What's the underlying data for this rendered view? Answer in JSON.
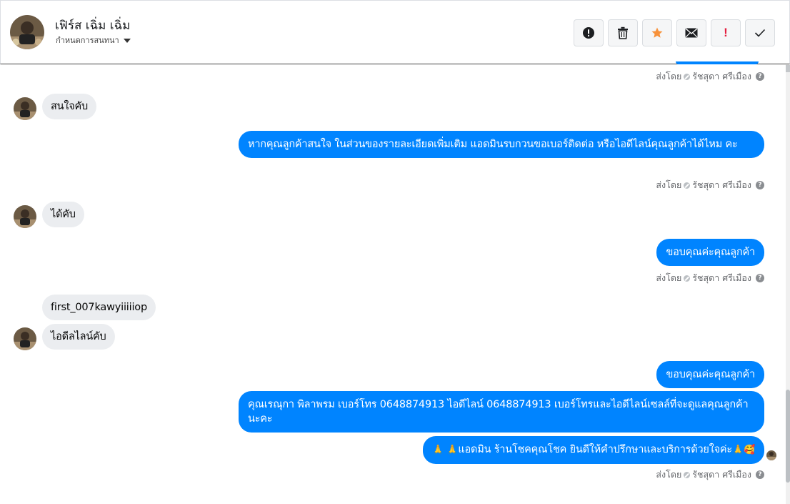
{
  "header": {
    "contact_name": "เฟิร์ส เฉิ่ม เฉิ่ม",
    "subtitle": "กำหนดการสนทนา",
    "toolbar_icons": [
      "alert-circle-icon",
      "trash-icon",
      "star-icon",
      "envelope-icon",
      "exclamation-icon",
      "check-icon"
    ],
    "exclamation_label": "!"
  },
  "colors": {
    "outgoing_bubble": "#0084ff",
    "incoming_bubble": "#ebedf0",
    "star": "#f7923b",
    "exclamation": "#e41e3f"
  },
  "sent_by": {
    "prefix": "ส่งโดย",
    "agent": "รัชสุดา ศรีเมือง",
    "help": "?"
  },
  "messages": [
    {
      "direction": "in",
      "text": "สนใจคับ"
    },
    {
      "direction": "out",
      "text": "หากคุณลูกค้าสนใจ ในส่วนของรายละเอียดเพิ่มเติม แอดมินรบกวนขอเบอร์ติดต่อ หรือไอดีไลน์คุณลูกค้าได้ไหม คะ"
    },
    {
      "direction": "in",
      "text": "ได้คับ"
    },
    {
      "direction": "out",
      "text": "ขอบคุณค่ะคุณลูกค้า"
    },
    {
      "direction": "in",
      "text": "first_007kawyiiiiiop"
    },
    {
      "direction": "in",
      "text": "ไอดีลไลน์คับ"
    },
    {
      "direction": "out",
      "text": "ขอบคุณค่ะคุณลูกค้า"
    },
    {
      "direction": "out",
      "text": "คุณเรณุกา พิลาพรม        เบอร์โทร 0648874913  ไอดีไลน์ 0648874913   เบอร์โทรและไอดีไลน์เซลล์ที่จะดูแลคุณลูกค้านะคะ"
    },
    {
      "direction": "out",
      "text": "แอดมิน ร้านโชคคุณโชค ยินดีให้คำปรึกษาและบริการด้วยใจค่ะ",
      "emojis": [
        "🙏",
        "🙏",
        "🙏",
        "🥰"
      ]
    }
  ]
}
